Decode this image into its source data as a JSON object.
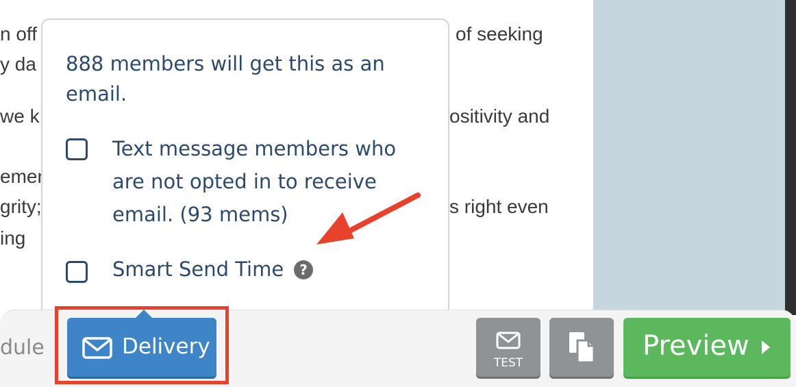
{
  "background_text": {
    "line1_left": "n off",
    "line1_right": "of seeking",
    "line2_left": "y da",
    "line3_left": "we k",
    "line3_right": "ositivity and",
    "line4_left": "emen",
    "line5_left": "grity;",
    "line5_right": "s right even",
    "line6_left": "ing"
  },
  "popover": {
    "summary": "888 members will get this as an email.",
    "option_text_message": "Text message members who are not opted in to receive email. (93 mems)",
    "option_smart_send": "Smart Send Time",
    "help_glyph": "?"
  },
  "footer": {
    "schedule_partial": "dule",
    "delivery_label": "Delivery",
    "test_label": "TEST",
    "preview_label": "Preview"
  },
  "colors": {
    "accent_blue": "#3d85c6",
    "preview_green": "#5cb85c",
    "annotation_red": "#e8412c",
    "popover_text": "#2c4a6e"
  }
}
